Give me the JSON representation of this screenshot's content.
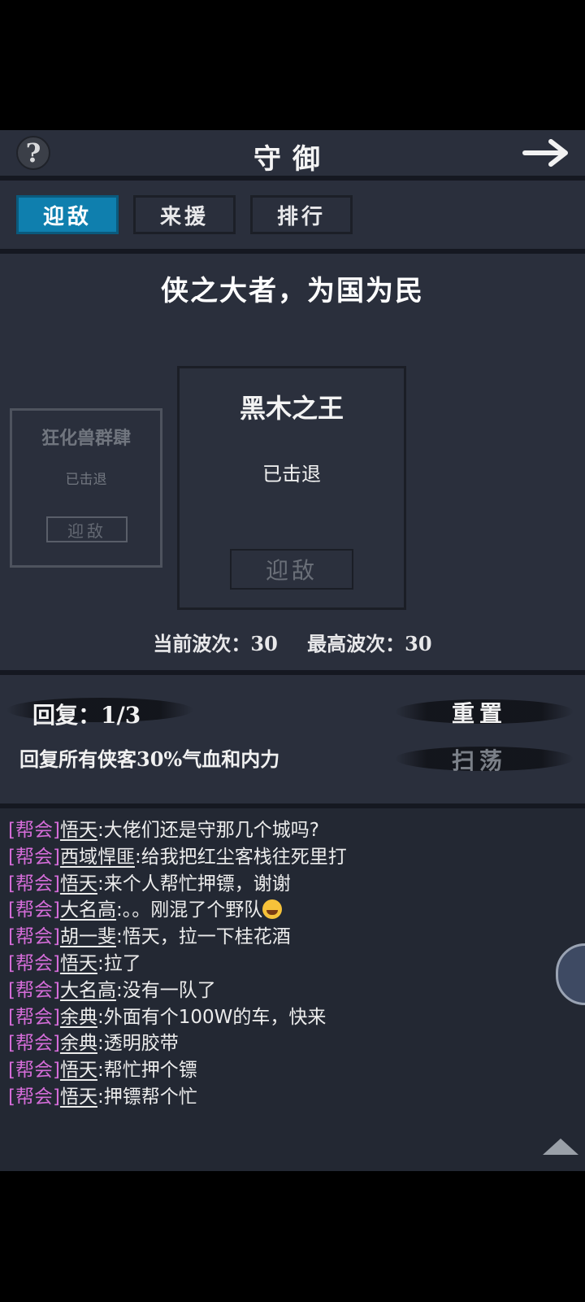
{
  "header": {
    "title": "守御",
    "help_icon": "question-icon",
    "back_icon": "arrow-right-icon"
  },
  "tabs": [
    {
      "label": "迎敌",
      "active": true
    },
    {
      "label": "来援",
      "active": false
    },
    {
      "label": "排行",
      "active": false
    }
  ],
  "motto": "侠之大者，为国为民",
  "cards": {
    "current": {
      "name": "黑木之王",
      "status": "已击退",
      "button": "迎敌"
    },
    "previous": {
      "name": "狂化兽群肆",
      "status": "已击退",
      "button": "迎敌"
    }
  },
  "waves": {
    "current_label": "当前波次：30",
    "best_label": "最高波次：30"
  },
  "recover": {
    "label": "回复：1/3",
    "desc": "回复所有侠客30%气血和内力",
    "reset_button": "重置",
    "sweep_button": "扫荡"
  },
  "chat": [
    {
      "tag": "[帮会]",
      "name": "悟天",
      "text": ":大佬们还是守那几个城吗?"
    },
    {
      "tag": "[帮会]",
      "name": "西域悍匪",
      "text": ":给我把红尘客栈往死里打"
    },
    {
      "tag": "[帮会]",
      "name": "悟天",
      "text": ":来个人帮忙押镖，谢谢"
    },
    {
      "tag": "[帮会]",
      "name": "大名高",
      "text": ":。。刚混了个野队",
      "emoji": true
    },
    {
      "tag": "[帮会]",
      "name": "胡一斐",
      "text": ":悟天，拉一下桂花酒"
    },
    {
      "tag": "[帮会]",
      "name": "悟天",
      "text": ":拉了"
    },
    {
      "tag": "[帮会]",
      "name": "大名高",
      "text": ":没有一队了"
    },
    {
      "tag": "[帮会]",
      "name": "余典",
      "text": ":外面有个100W的车，快来"
    },
    {
      "tag": "[帮会]",
      "name": "余典",
      "text": ":透明胶带"
    },
    {
      "tag": "[帮会]",
      "name": "悟天",
      "text": ":帮忙押个镖"
    },
    {
      "tag": "[帮会]",
      "name": "悟天",
      "text": ":押镖帮个忙"
    }
  ],
  "colors": {
    "accent": "#0f7fae",
    "guild_tag": "#d46cd8",
    "panel": "#2a2f3c"
  }
}
